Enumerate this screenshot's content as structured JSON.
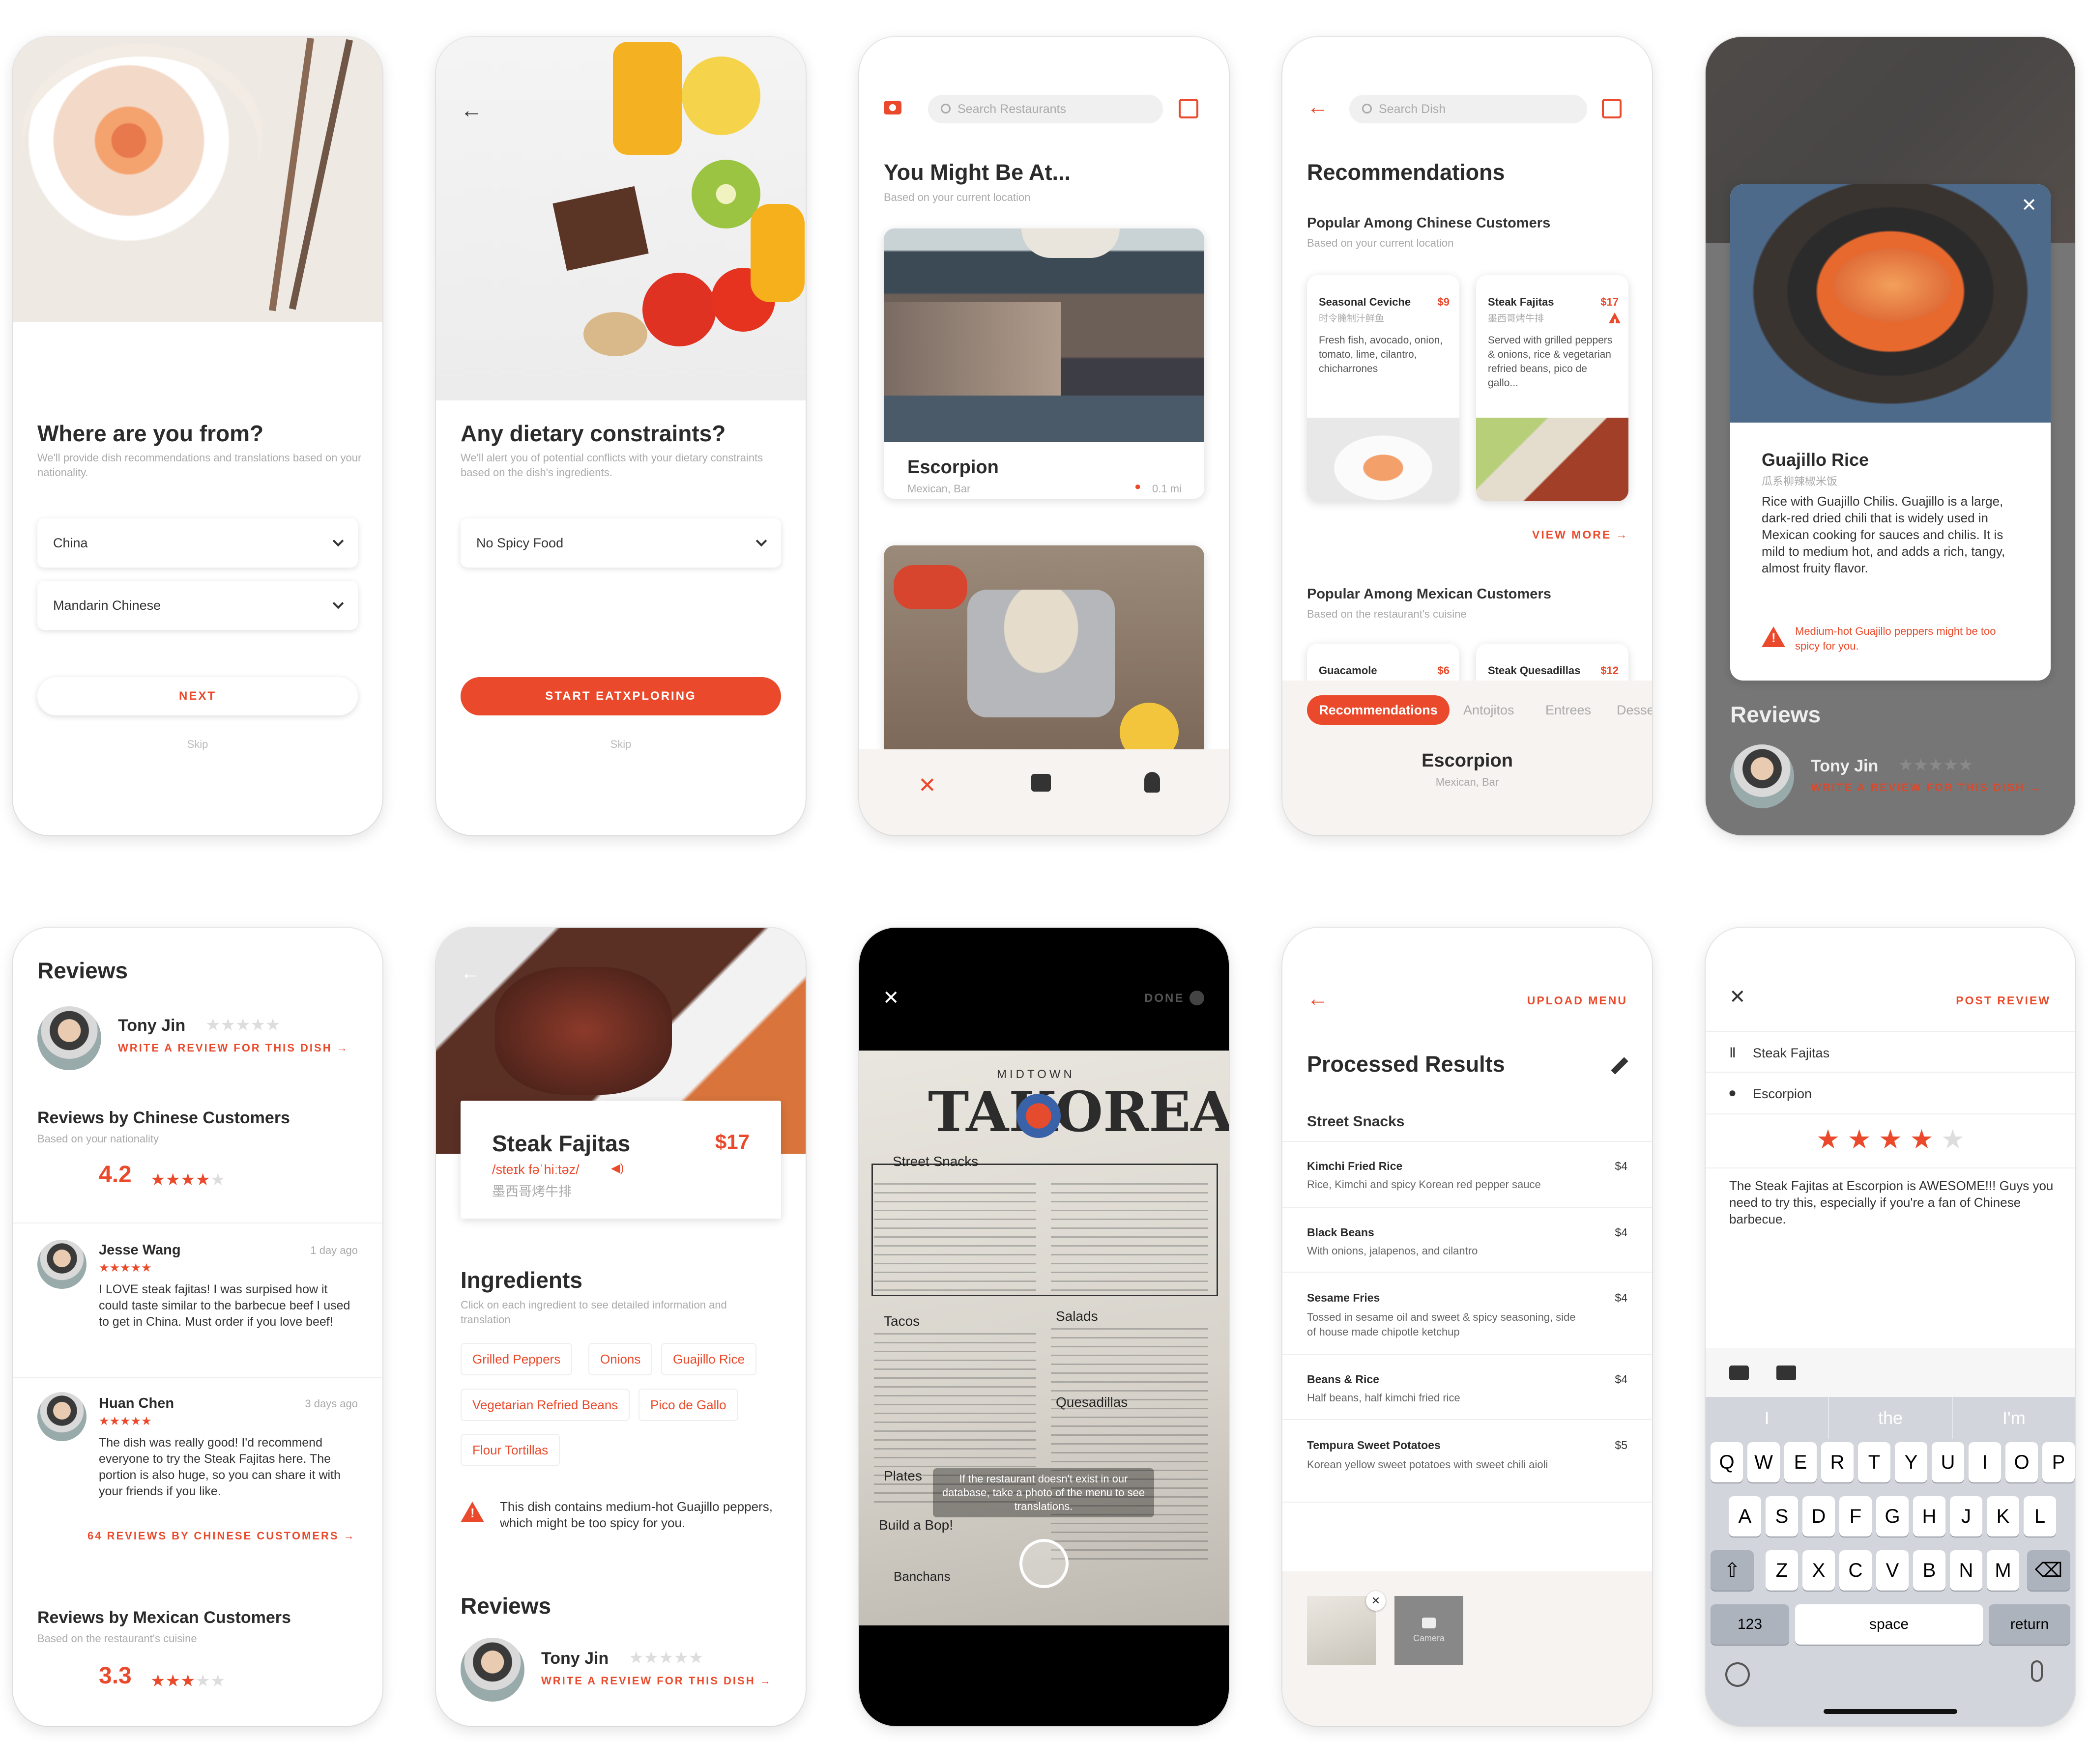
{
  "screen1": {
    "title": "Where are you from?",
    "subtitle": "We'll provide dish recommendations and translations based on your nationality.",
    "country": "China",
    "language": "Mandarin Chinese",
    "next_label": "NEXT",
    "skip_label": "Skip"
  },
  "screen2": {
    "title": "Any dietary constraints?",
    "subtitle": "We'll alert you of potential conflicts with your dietary constraints based on the dish's ingredients.",
    "constraint": "No Spicy Food",
    "start_label": "START EATXPLORING",
    "skip_label": "Skip"
  },
  "screen3": {
    "search_placeholder": "Search Restaurants",
    "title": "You Might Be At...",
    "subtitle": "Based on your current location",
    "restaurant_name": "Escorpion",
    "restaurant_type": "Mexican, Bar",
    "distance": "0.1 mi"
  },
  "screen4": {
    "search_placeholder": "Search Dish",
    "title": "Recommendations",
    "section1_title": "Popular Among Chinese Customers",
    "section1_sub": "Based on your current location",
    "dish1": {
      "name": "Seasonal Ceviche",
      "price": "$9",
      "cn": "时令腌制汁鲜鱼",
      "desc": "Fresh fish, avocado, onion, tomato, lime, cilantro, chicharrones"
    },
    "dish2": {
      "name": "Steak Fajitas",
      "price": "$17",
      "cn": "墨西哥烤牛排",
      "desc": "Served with grilled peppers & onions, rice & vegetarian refried beans, pico de gallo..."
    },
    "view_more": "VIEW MORE",
    "section2_title": "Popular Among Mexican Customers",
    "section2_sub": "Based on the restaurant's cuisine",
    "dish3": {
      "name": "Guacamole",
      "price": "$6"
    },
    "dish4": {
      "name": "Steak Quesadillas",
      "price": "$12"
    },
    "tabs": [
      "Recommendations",
      "Antojitos",
      "Entrees",
      "Desse"
    ],
    "restaurant_name": "Escorpion",
    "restaurant_type": "Mexican, Bar"
  },
  "screen5": {
    "dish_name": "Guajillo Rice",
    "dish_cn": "瓜系柳辣椒米饭",
    "dish_desc": "Rice with Guajillo Chilis. Guajillo is a large, dark-red dried chili that is widely used in Mexican cooking for sauces and chilis. It is mild to medium hot, and adds a rich, tangy, almost fruity flavor.",
    "warning": "Medium-hot Guajillo peppers might be too spicy for you.",
    "reviews_title": "Reviews",
    "reviewer": "Tony Jin",
    "write_review": "WRITE A REVIEW FOR THIS DISH"
  },
  "screen6": {
    "title": "Reviews",
    "reviewer": "Tony Jin",
    "write_review": "WRITE A REVIEW FOR THIS DISH",
    "chinese_title": "Reviews by Chinese Customers",
    "chinese_sub": "Based on your nationality",
    "chinese_score": "4.2",
    "chinese_rating": 4,
    "review1": {
      "name": "Jesse Wang",
      "time": "1 day ago",
      "text": "I LOVE steak fajitas! I was surpised how it could taste similar to the barbecue beef I used to get in China. Must order if you love beef!"
    },
    "review2": {
      "name": "Huan Chen",
      "time": "3 days ago",
      "text": "The dish was really good! I'd recommend everyone to try the Steak Fajitas here. The portion is also huge, so you can share it with your friends if you like."
    },
    "more_reviews": "64 REVIEWS BY CHINESE CUSTOMERS",
    "mexican_title": "Reviews by Mexican Customers",
    "mexican_sub": "Based on the restaurant's cuisine",
    "mexican_score": "3.3",
    "mexican_rating": 3
  },
  "screen7": {
    "dish_name": "Steak Fajitas",
    "price": "$17",
    "phonetic": "/steɪk fəˈhiːtəz/",
    "cn": "墨西哥烤牛排",
    "ingredients_title": "Ingredients",
    "ingredients_sub": "Click on each ingredient to see detailed information and translation",
    "ingredients": [
      "Grilled Peppers",
      "Onions",
      "Guajillo Rice",
      "Vegetarian Refried Beans",
      "Pico de Gallo",
      "Flour Tortillas"
    ],
    "warning": "This dish contains medium-hot Guajillo peppers, which might be too spicy for you.",
    "reviews_title": "Reviews",
    "reviewer": "Tony Jin",
    "write_review": "WRITE A REVIEW FOR THIS DISH"
  },
  "screen8": {
    "done_label": "DONE",
    "menu_brand_top": "MIDTOWN",
    "menu_brand": "TAKOREA",
    "menu_sections": [
      "Street Snacks",
      "Tacos",
      "Salads",
      "Quesadillas",
      "Build a Bop!",
      "Plates",
      "Banchans"
    ],
    "hint": "If the restaurant doesn't exist in our database, take a photo of the menu to see translations."
  },
  "screen9": {
    "upload_label": "UPLOAD MENU",
    "title": "Processed Results",
    "section": "Street Snacks",
    "items": [
      {
        "name": "Kimchi Fried Rice",
        "desc": "Rice, Kimchi and spicy Korean red pepper sauce",
        "price": "$4"
      },
      {
        "name": "Black Beans",
        "desc": "With onions, jalapenos, and cilantro",
        "price": "$4"
      },
      {
        "name": "Sesame Fries",
        "desc": "Tossed in sesame oil and sweet & spicy seasoning, side of house made chipotle ketchup",
        "price": "$4"
      },
      {
        "name": "Beans & Rice",
        "desc": "Half beans, half kimchi fried rice",
        "price": "$4"
      },
      {
        "name": "Tempura Sweet Potatoes",
        "desc": "Korean yellow sweet potatoes with sweet chili aioli",
        "price": "$5"
      }
    ],
    "camera_label": "Camera"
  },
  "screen10": {
    "post_label": "POST REVIEW",
    "dish": "Steak Fajitas",
    "restaurant": "Escorpion",
    "rating": 4,
    "review_text": "The Steak Fajitas at Escorpion is AWESOME!!! Guys you need to try this, especially if you're a fan of Chinese barbecue.",
    "suggestions": [
      "I",
      "the",
      "I'm"
    ],
    "row1": [
      "Q",
      "W",
      "E",
      "R",
      "T",
      "Y",
      "U",
      "I",
      "O",
      "P"
    ],
    "row2": [
      "A",
      "S",
      "D",
      "F",
      "G",
      "H",
      "J",
      "K",
      "L"
    ],
    "row3": [
      "Z",
      "X",
      "C",
      "V",
      "B",
      "N",
      "M"
    ],
    "key_123": "123",
    "key_space": "space",
    "key_return": "return"
  },
  "colors": {
    "accent": "#ea4a2b",
    "text": "#2b2b2b",
    "muted": "#aaaaaa"
  }
}
